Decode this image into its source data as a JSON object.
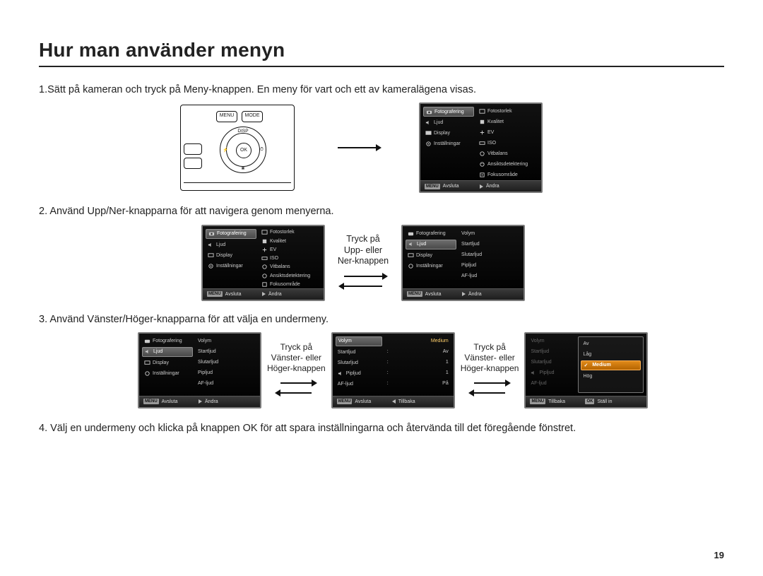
{
  "title": "Hur man använder menyn",
  "page_number": "19",
  "steps": {
    "s1": "1.Sätt på kameran och tryck på Meny-knappen. En meny för vart och ett av kameralägena visas.",
    "s2": "2. Använd Upp/Ner-knapparna för att navigera genom menyerna.",
    "s3": "3. Använd Vänster/Höger-knapparna för att välja en undermeny.",
    "s4": "4. Välj en undermeny och klicka på knappen OK för att spara inställningarna och återvända till det föregående fönstret."
  },
  "camera_back": {
    "menu_btn": "MENU",
    "mode_btn": "MODE",
    "ok": "OK",
    "disp": "DISP",
    "flash": "⚡",
    "timer": "⏱",
    "macro": "❀"
  },
  "captions": {
    "updown": "Tryck på\nUpp- eller\nNer-knappen",
    "lr1": "Tryck på\nVänster- eller\nHöger-knappen",
    "lr2": "Tryck på\nVänster- eller\nHöger-knappen"
  },
  "left_tabs": {
    "fotografering": "Fotografering",
    "ljud": "Ljud",
    "display": "Display",
    "installningar": "Inställningar"
  },
  "right_foto": {
    "fotostorlek": "Fotostorlek",
    "kvalitet": "Kvalitet",
    "ev": "EV",
    "iso": "ISO",
    "vitbalans": "Vitbalans",
    "ansikts": "Ansiktsdetektering",
    "fokus": "Fokusområde"
  },
  "right_ljud": {
    "volym": "Volym",
    "startljud": "Startljud",
    "slutarljud": "Slutarljud",
    "pipljud": "Pipljud",
    "afljud": "AF-ljud"
  },
  "values": {
    "volym": "Medium",
    "startljud": "Av",
    "slutarljud": "1",
    "pipljud": "1",
    "afljud": "På"
  },
  "volym_options": {
    "av": "Av",
    "lag": "Låg",
    "medium": "Medium",
    "hog": "Hög"
  },
  "footer": {
    "menu_tag": "MENU",
    "avsluta": "Avsluta",
    "andra": "Ändra",
    "tillbaka": "Tillbaka",
    "stallin": "Ställ in"
  }
}
